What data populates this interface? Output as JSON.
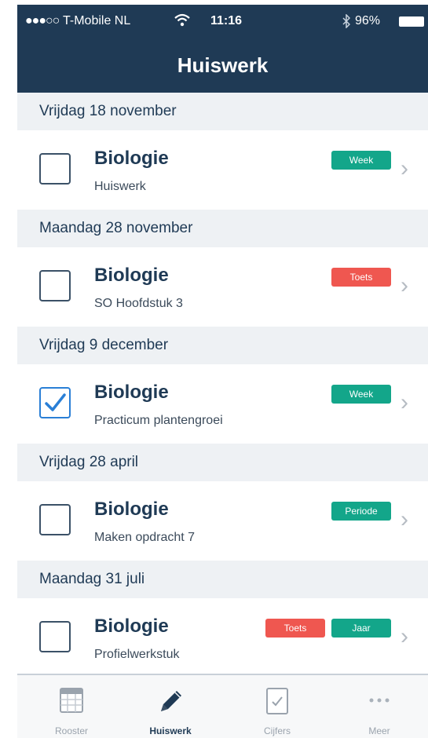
{
  "status": {
    "signal": "●●●○○",
    "carrier": "T-Mobile NL",
    "time": "11:16",
    "battery": "96%"
  },
  "header": {
    "title": "Huiswerk"
  },
  "list": [
    {
      "date": "Vrijdag 18 november",
      "subject": "Biologie",
      "description": "Huiswerk",
      "checked": false,
      "badges": [
        {
          "label": "Week",
          "color": "#13a68a"
        }
      ]
    },
    {
      "date": "Maandag 28 november",
      "subject": "Biologie",
      "description": "SO Hoofdstuk 3",
      "checked": false,
      "badges": [
        {
          "label": "Toets",
          "color": "#ef5750"
        }
      ]
    },
    {
      "date": "Vrijdag 9 december",
      "subject": "Biologie",
      "description": "Practicum plantengroei",
      "checked": true,
      "badges": [
        {
          "label": "Week",
          "color": "#13a68a"
        }
      ]
    },
    {
      "date": "Vrijdag 28 april",
      "subject": "Biologie",
      "description": "Maken opdracht 7",
      "checked": false,
      "badges": [
        {
          "label": "Periode",
          "color": "#13a68a"
        }
      ]
    },
    {
      "date": "Maandag 31 juli",
      "subject": "Biologie",
      "description": "Profielwerkstuk",
      "checked": false,
      "badges": [
        {
          "label": "Toets",
          "color": "#ef5750"
        },
        {
          "label": "Jaar",
          "color": "#13a68a"
        }
      ]
    }
  ],
  "tabs": [
    {
      "label": "Rooster",
      "icon": "calendar-icon",
      "active": false
    },
    {
      "label": "Huiswerk",
      "icon": "pencil-icon",
      "active": true
    },
    {
      "label": "Cijfers",
      "icon": "grade-check-icon",
      "active": false
    },
    {
      "label": "Meer",
      "icon": "more-dots-icon",
      "active": false
    }
  ],
  "colors": {
    "header_bg": "#1f3a55",
    "section_bg": "#eef1f4",
    "accent_blue": "#2a7fd6",
    "badge_green": "#13a68a",
    "badge_red": "#ef5750"
  }
}
